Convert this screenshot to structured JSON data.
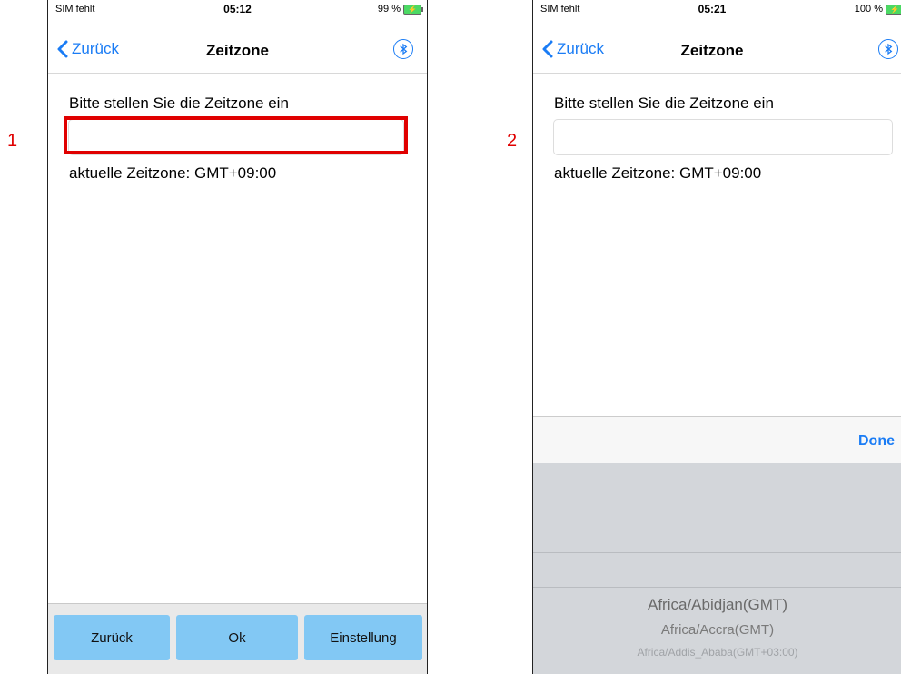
{
  "step_labels": [
    "1",
    "2"
  ],
  "screen1": {
    "status": {
      "carrier": "SIM fehlt",
      "time": "05:12",
      "battery": "99 %"
    },
    "nav": {
      "back": "Zurück",
      "title": "Zeitzone"
    },
    "prompt": "Bitte stellen Sie die Zeitzone ein",
    "timezone_input": {
      "value": ""
    },
    "current_timezone": "aktuelle Zeitzone: GMT+09:00",
    "buttons": {
      "back": "Zurück",
      "ok": "Ok",
      "settings": "Einstellung"
    }
  },
  "screen2": {
    "status": {
      "carrier": "SIM fehlt",
      "time": "05:21",
      "battery": "100 %"
    },
    "nav": {
      "back": "Zurück",
      "title": "Zeitzone"
    },
    "prompt": "Bitte stellen Sie die Zeitzone ein",
    "timezone_input": {
      "value": ""
    },
    "current_timezone": "aktuelle Zeitzone: GMT+09:00",
    "toolbar": {
      "done": "Done"
    },
    "picker_options": [
      "Africa/Abidjan(GMT)",
      "Africa/Accra(GMT)",
      "Africa/Addis_Ababa(GMT+03:00)"
    ]
  },
  "colors": {
    "accent": "#1a7cf5",
    "highlight": "#e00000",
    "button": "#82c8f4"
  }
}
